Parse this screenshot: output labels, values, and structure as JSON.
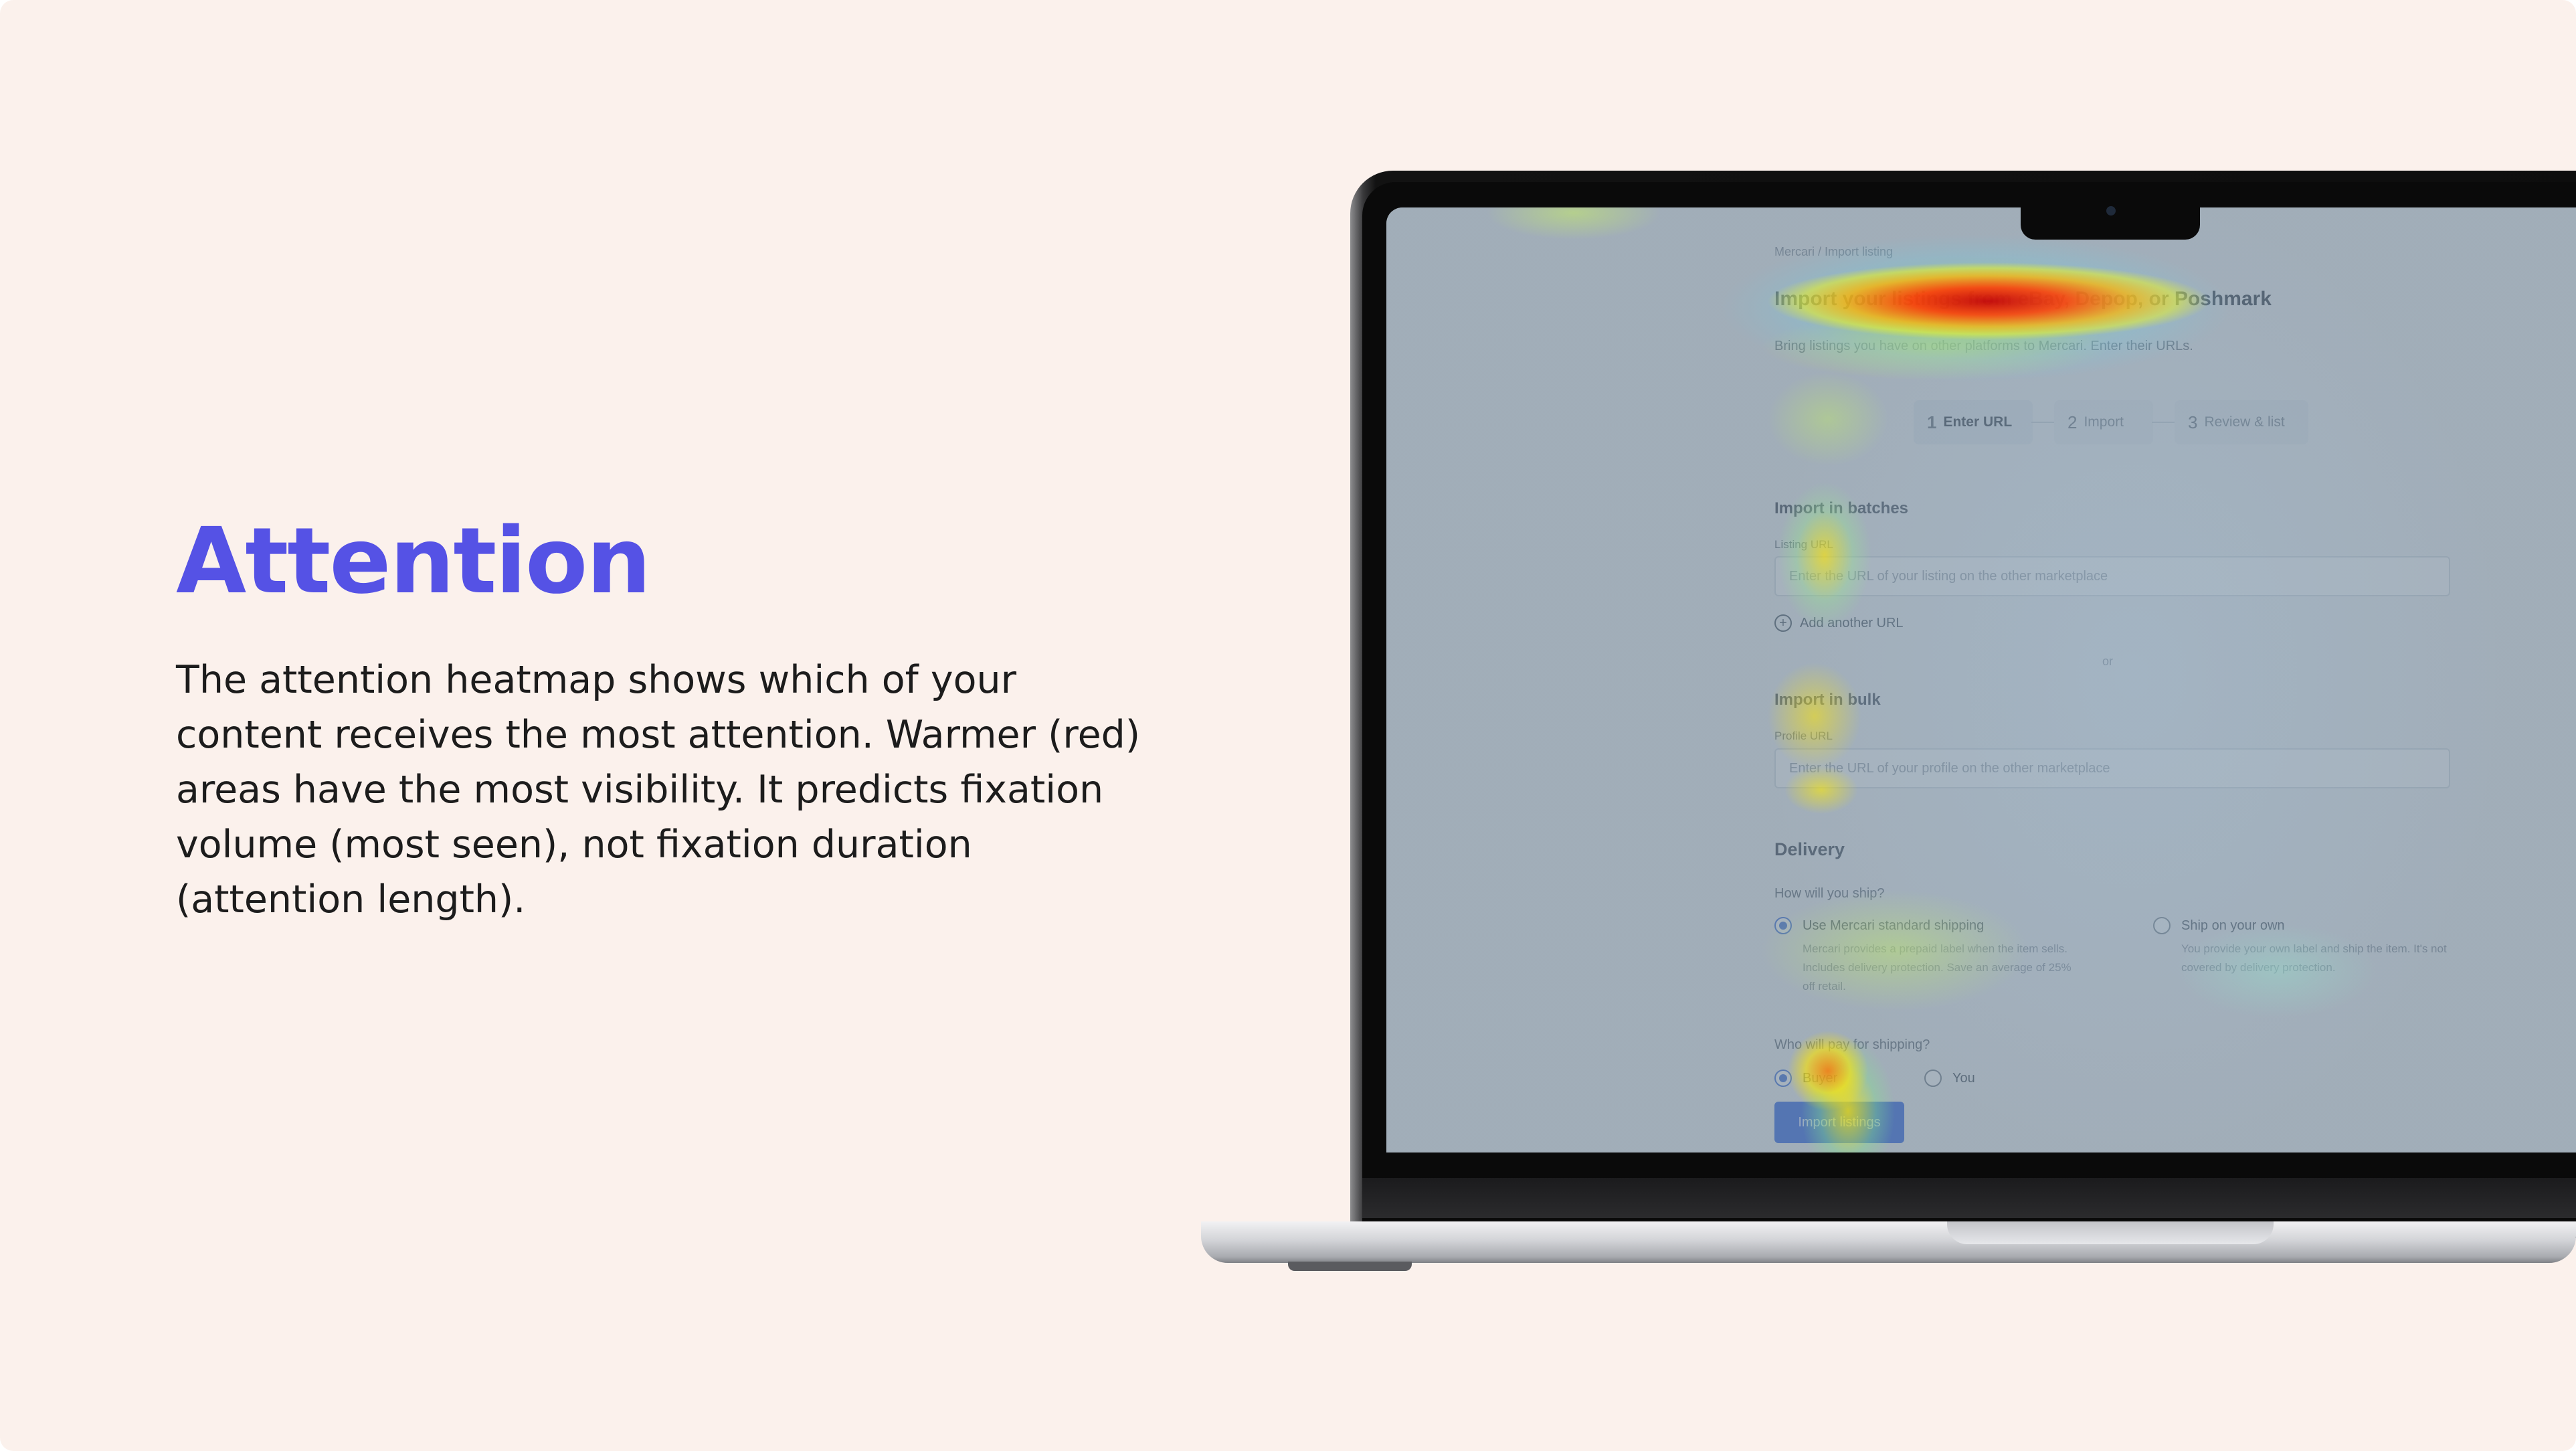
{
  "slide": {
    "heading": "Attention",
    "description": "The attention heatmap shows which of your content receives the most attention. Warmer (red) areas have the most visibility. It predicts fixation volume (most seen), not fixation duration (attention length).",
    "accent_color": "#5552e5",
    "background_color": "#fbf1ec"
  },
  "screen": {
    "breadcrumb": "Mercari / Import listing",
    "title": "Import your listings from eBay, Depop, or Poshmark",
    "subtitle": "Bring listings you have on other platforms to Mercari. Enter their URLs.",
    "steps": [
      {
        "num": "1",
        "label": "Enter URL",
        "active": true
      },
      {
        "num": "2",
        "label": "Import",
        "active": false
      },
      {
        "num": "3",
        "label": "Review & list",
        "active": false
      }
    ],
    "batches": {
      "title": "Import in batches",
      "field_label": "Listing URL",
      "placeholder": "Enter the URL of your listing on the other marketplace",
      "add_label": "Add another URL"
    },
    "or_label": "or",
    "bulk": {
      "title": "Import in bulk",
      "field_label": "Profile URL",
      "placeholder": "Enter the URL of your profile on the other marketplace"
    },
    "delivery": {
      "title": "Delivery",
      "question": "How will you ship?",
      "options": [
        {
          "label": "Use Mercari standard shipping",
          "desc": "Mercari provides a prepaid label when the item sells. Includes delivery protection. Save an average of 25% off retail.",
          "checked": true
        },
        {
          "label": "Ship on your own",
          "desc": "You provide your own label and ship the item. It's not covered by delivery protection.",
          "checked": false
        }
      ],
      "payer_question": "Who will pay for shipping?",
      "payer_options": [
        {
          "label": "Buyer",
          "checked": true
        },
        {
          "label": "You",
          "checked": false
        }
      ]
    },
    "submit_label": "Import listings"
  }
}
